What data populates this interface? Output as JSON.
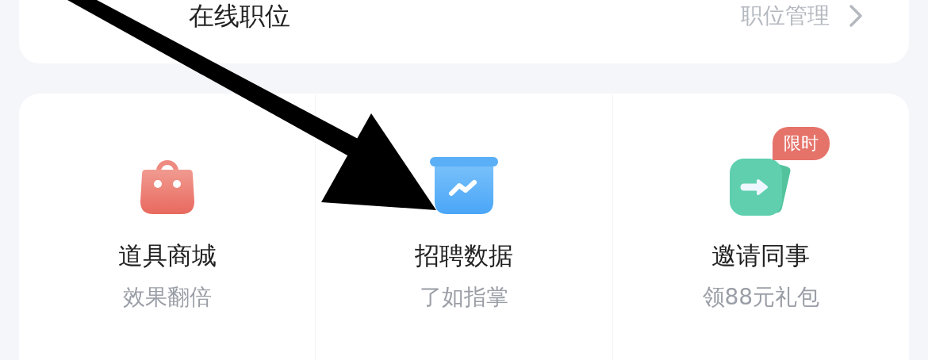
{
  "positions_card": {
    "title": "在线职位",
    "link": "职位管理"
  },
  "tools": [
    {
      "kind": "bag",
      "title": "道具商城",
      "subtitle": "效果翻倍"
    },
    {
      "kind": "chart",
      "title": "招聘数据",
      "subtitle": "了如指掌"
    },
    {
      "kind": "share",
      "title": "邀请同事",
      "subtitle": "领88元礼包",
      "badge": "限时"
    }
  ]
}
